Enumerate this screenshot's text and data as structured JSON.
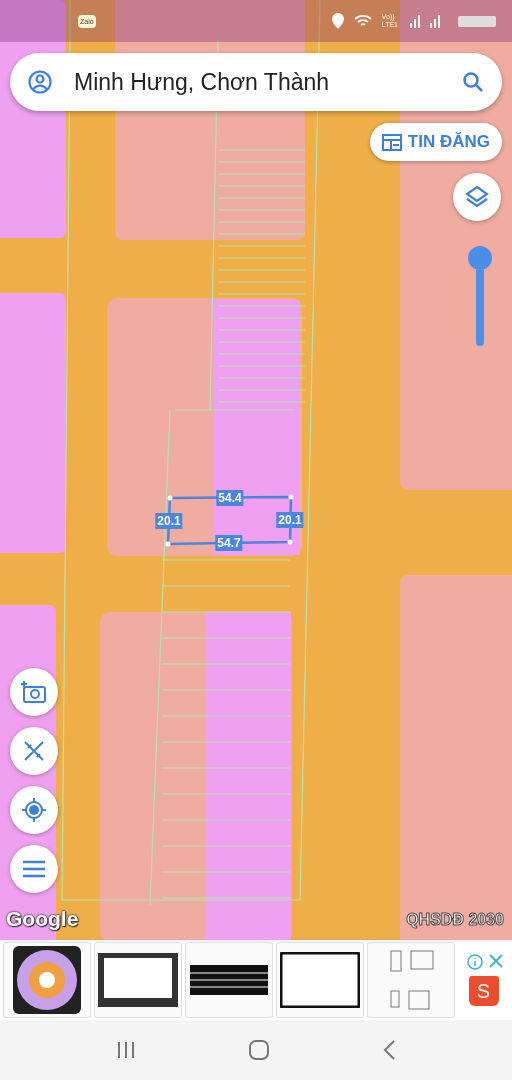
{
  "status_bar": {
    "app_icon": "Zalo",
    "voice_label": "Vo))",
    "network_label": "LTE1"
  },
  "search": {
    "value": "Minh Hưng, Chơn Thành"
  },
  "listings_button": {
    "label": "TIN ĐĂNG"
  },
  "zoom_slider": {
    "level": 1
  },
  "measurements": [
    "54.4",
    "20.1",
    "20.1",
    "54.7"
  ],
  "map_tools": [
    {
      "kind": "camera"
    },
    {
      "kind": "ruler"
    },
    {
      "kind": "locate"
    },
    {
      "kind": "menu"
    }
  ],
  "attribution": "Google",
  "layer_name": "QHSDĐ 2030",
  "ad": {
    "products": [
      {
        "kind": "fan"
      },
      {
        "kind": "screen"
      },
      {
        "kind": "keyboard"
      },
      {
        "kind": "bezel"
      },
      {
        "kind": "diagram"
      }
    ],
    "store_letter": "S"
  }
}
